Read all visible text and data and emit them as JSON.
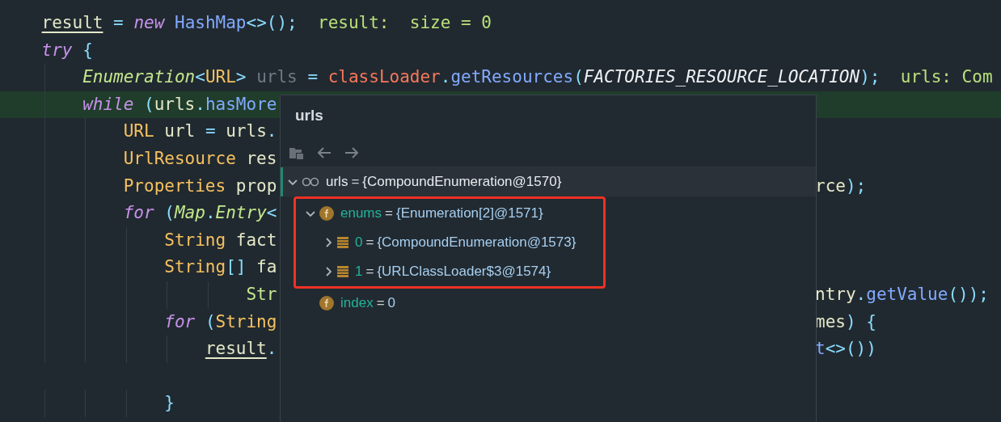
{
  "editor": {
    "lines": [
      {
        "current": false,
        "left": [
          {
            "text": "    result",
            "kind": "var"
          },
          {
            "text": " = ",
            "kind": "punct"
          },
          {
            "text": "new",
            "kind": "kw"
          },
          {
            "text": " HashMap",
            "kind": "cls"
          },
          {
            "text": "<>();",
            "kind": "punct"
          },
          {
            "text": "  result:  size = 0",
            "kind": "debug"
          }
        ]
      },
      {
        "current": false,
        "left": [
          {
            "text": "    try",
            "kind": "kw"
          },
          {
            "text": " {",
            "kind": "punct"
          }
        ]
      },
      {
        "current": false,
        "left": [
          {
            "text": "        Enumeration",
            "kind": "iface"
          },
          {
            "text": "<",
            "kind": "punct"
          },
          {
            "text": "URL",
            "kind": "type"
          },
          {
            "text": ">",
            "kind": "punct"
          },
          {
            "text": " urls",
            "kind": "unused"
          },
          {
            "text": " = ",
            "kind": "punct"
          },
          {
            "text": "classLoader",
            "kind": "field"
          },
          {
            "text": ".",
            "kind": "punct"
          },
          {
            "text": "getResources",
            "kind": "method"
          },
          {
            "text": "(",
            "kind": "punct"
          },
          {
            "text": "FACTORIES_RESOURCE_LOCATION",
            "kind": "const"
          },
          {
            "text": ");",
            "kind": "punct"
          },
          {
            "text": "  urls: Com",
            "kind": "debug"
          }
        ]
      },
      {
        "current": true,
        "left": [
          {
            "text": "        while",
            "kind": "kw"
          },
          {
            "text": " (",
            "kind": "punct"
          },
          {
            "text": "urls",
            "kind": "plain"
          },
          {
            "text": ".",
            "kind": "punct"
          },
          {
            "text": "hasMore",
            "kind": "method"
          }
        ]
      },
      {
        "current": false,
        "left": [
          {
            "text": "            URL",
            "kind": "type"
          },
          {
            "text": " url ",
            "kind": "plain"
          },
          {
            "text": "=",
            "kind": "punct"
          },
          {
            "text": " urls",
            "kind": "plain"
          },
          {
            "text": ".",
            "kind": "punct"
          }
        ]
      },
      {
        "current": false,
        "left": [
          {
            "text": "            UrlResource",
            "kind": "type"
          },
          {
            "text": " res",
            "kind": "plain"
          }
        ]
      },
      {
        "current": false,
        "left": [
          {
            "text": "            Properties",
            "kind": "type"
          },
          {
            "text": " prop",
            "kind": "plain"
          }
        ],
        "right": [
          {
            "text": "rce",
            "kind": "plain"
          },
          {
            "text": ");",
            "kind": "punct"
          }
        ]
      },
      {
        "current": false,
        "left": [
          {
            "text": "            for",
            "kind": "kw"
          },
          {
            "text": " (",
            "kind": "punct"
          },
          {
            "text": "Map",
            "kind": "iface"
          },
          {
            "text": ".",
            "kind": "punct"
          },
          {
            "text": "Entry",
            "kind": "iface"
          },
          {
            "text": "<",
            "kind": "punct"
          }
        ]
      },
      {
        "current": false,
        "left": [
          {
            "text": "                String",
            "kind": "type"
          },
          {
            "text": " fact",
            "kind": "plain"
          }
        ]
      },
      {
        "current": false,
        "left": [
          {
            "text": "                String",
            "kind": "type"
          },
          {
            "text": "[]",
            "kind": "punct"
          },
          {
            "text": " fa",
            "kind": "plain"
          }
        ]
      },
      {
        "current": false,
        "left": [
          {
            "text": "                        Str",
            "kind": "green"
          }
        ],
        "right": [
          {
            "text": "ntry",
            "kind": "plain"
          },
          {
            "text": ".",
            "kind": "punct"
          },
          {
            "text": "getValue",
            "kind": "method"
          },
          {
            "text": "());",
            "kind": "punct"
          }
        ]
      },
      {
        "current": false,
        "left": [
          {
            "text": "                for",
            "kind": "kw"
          },
          {
            "text": " (",
            "kind": "punct"
          },
          {
            "text": "String",
            "kind": "type"
          }
        ],
        "right": [
          {
            "text": "mes",
            "kind": "plain"
          },
          {
            "text": ") {",
            "kind": "punct"
          }
        ]
      },
      {
        "current": false,
        "left": [
          {
            "text": "                    result",
            "kind": "var"
          },
          {
            "text": ".",
            "kind": "punct"
          }
        ],
        "right": [
          {
            "text": "t",
            "kind": "method"
          },
          {
            "text": "<>())",
            "kind": "punct"
          }
        ]
      },
      {
        "current": false
      },
      {
        "current": false,
        "left": [
          {
            "text": "                }",
            "kind": "punct"
          }
        ]
      }
    ]
  },
  "popup": {
    "title": "urls",
    "tree": [
      {
        "kind": "watch",
        "name": "urls",
        "separator": "=",
        "value": "{CompoundEnumeration@1570}",
        "expandable": true,
        "expanded": true,
        "selected": true,
        "highlighted": false,
        "children": [
          {
            "kind": "field",
            "name": "enums",
            "separator": "=",
            "value": "{Enumeration[2]@1571}",
            "expandable": true,
            "expanded": true,
            "selected": false,
            "highlighted": true,
            "children": [
              {
                "kind": "element",
                "name": "0",
                "separator": "=",
                "value": "{CompoundEnumeration@1573}",
                "expandable": true,
                "expanded": false,
                "selected": false,
                "highlighted": false
              },
              {
                "kind": "element",
                "name": "1",
                "separator": "=",
                "value": "{URLClassLoader$3@1574}",
                "expandable": true,
                "expanded": false,
                "selected": false,
                "highlighted": false
              }
            ]
          },
          {
            "kind": "field",
            "name": "index",
            "separator": "=",
            "value": "0",
            "expandable": false,
            "selected": false,
            "highlighted": false
          }
        ]
      }
    ]
  }
}
